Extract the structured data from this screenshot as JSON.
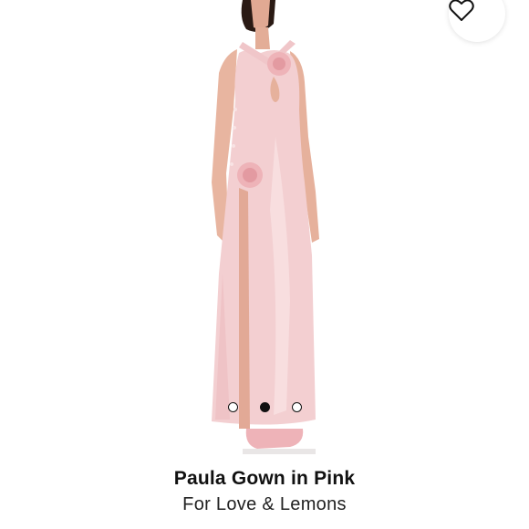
{
  "product": {
    "name": "Paula Gown in Pink",
    "brand": "For Love & Lemons"
  },
  "wishlist": {
    "icon": "heart-icon"
  },
  "carousel": {
    "count": 3,
    "active_index": 1
  },
  "colors": {
    "gown": "#f3cfd1",
    "skin": "#e7b39f",
    "accent": "#111111"
  }
}
